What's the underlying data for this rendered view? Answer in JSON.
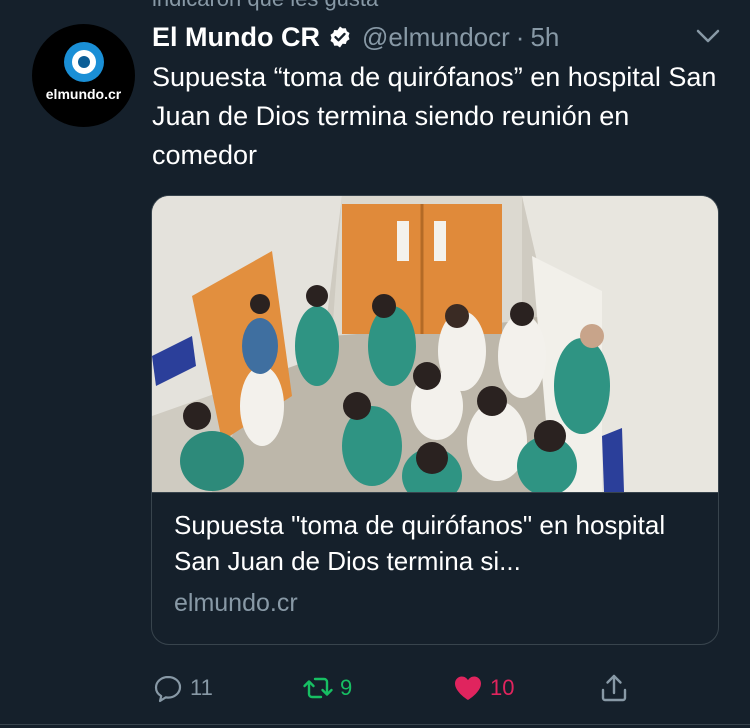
{
  "social_context": "indicaron que les gusta",
  "tweet": {
    "avatar_text": "elmundo.cr",
    "display_name": "El Mundo CR",
    "handle": "@elmundocr",
    "separator": "·",
    "time": "5h",
    "text": "Supuesta “toma de quirófanos” en hospital San Juan de Dios termina siendo reunión en comedor"
  },
  "card": {
    "title": "Supuesta \"toma de quirófanos\" en hospital San Juan de Dios termina si...",
    "domain": "elmundo.cr"
  },
  "actions": {
    "reply_count": "11",
    "retweet_count": "9",
    "like_count": "10"
  },
  "colors": {
    "background": "#15202b",
    "secondary_text": "#8899a6",
    "verified": "#ffffff",
    "retweet_green": "#17bf63",
    "like_red": "#e0245e",
    "border": "#38444d"
  }
}
